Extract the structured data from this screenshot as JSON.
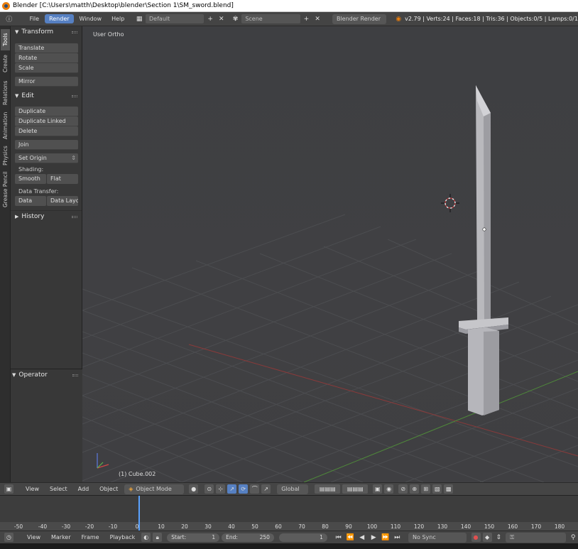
{
  "window": {
    "title": "Blender [C:\\Users\\matth\\Desktop\\blender\\Section 1\\SM_sword.blend]"
  },
  "info_header": {
    "menus": [
      "File",
      "Render",
      "Window",
      "Help"
    ],
    "active_menu": "Render",
    "screen_layout": "Default",
    "scene": "Scene",
    "render_engine": "Blender Render",
    "stats": "v2.79 | Verts:24 | Faces:18 | Tris:36 | Objects:0/5 | Lamps:0/1"
  },
  "tabs": [
    "Tools",
    "Create",
    "Relations",
    "Animation",
    "Physics",
    "Grease Pencil"
  ],
  "toolshelf": {
    "transform": {
      "title": "Transform",
      "items": [
        "Translate",
        "Rotate",
        "Scale",
        "Mirror"
      ]
    },
    "edit": {
      "title": "Edit",
      "items": [
        "Duplicate",
        "Duplicate Linked",
        "Delete",
        "Join"
      ],
      "set_origin": "Set Origin",
      "shading_label": "Shading:",
      "shading_buttons": [
        "Smooth",
        "Flat"
      ],
      "data_transfer_label": "Data Transfer:",
      "data_buttons": [
        "Data",
        "Data Layo"
      ]
    },
    "history": {
      "title": "History"
    },
    "operator": {
      "title": "Operator"
    }
  },
  "viewport": {
    "view_name": "User Ortho",
    "object_name": "(1) Cube.002"
  },
  "view3d_header": {
    "menus": [
      "View",
      "Select",
      "Add",
      "Object"
    ],
    "mode": "Object Mode",
    "orientation": "Global"
  },
  "timeline": {
    "ticks": [
      "-50",
      "-40",
      "-30",
      "-20",
      "-10",
      "0",
      "10",
      "20",
      "30",
      "40",
      "50",
      "60",
      "70",
      "80",
      "90",
      "100",
      "110",
      "120",
      "130",
      "140",
      "150",
      "160",
      "170",
      "180"
    ],
    "current_frame": 1
  },
  "timeline_header": {
    "menus": [
      "View",
      "Marker",
      "Frame",
      "Playback"
    ],
    "start_label": "Start:",
    "start_value": "1",
    "end_label": "End:",
    "end_value": "250",
    "current_value": "1",
    "sync": "No Sync"
  }
}
